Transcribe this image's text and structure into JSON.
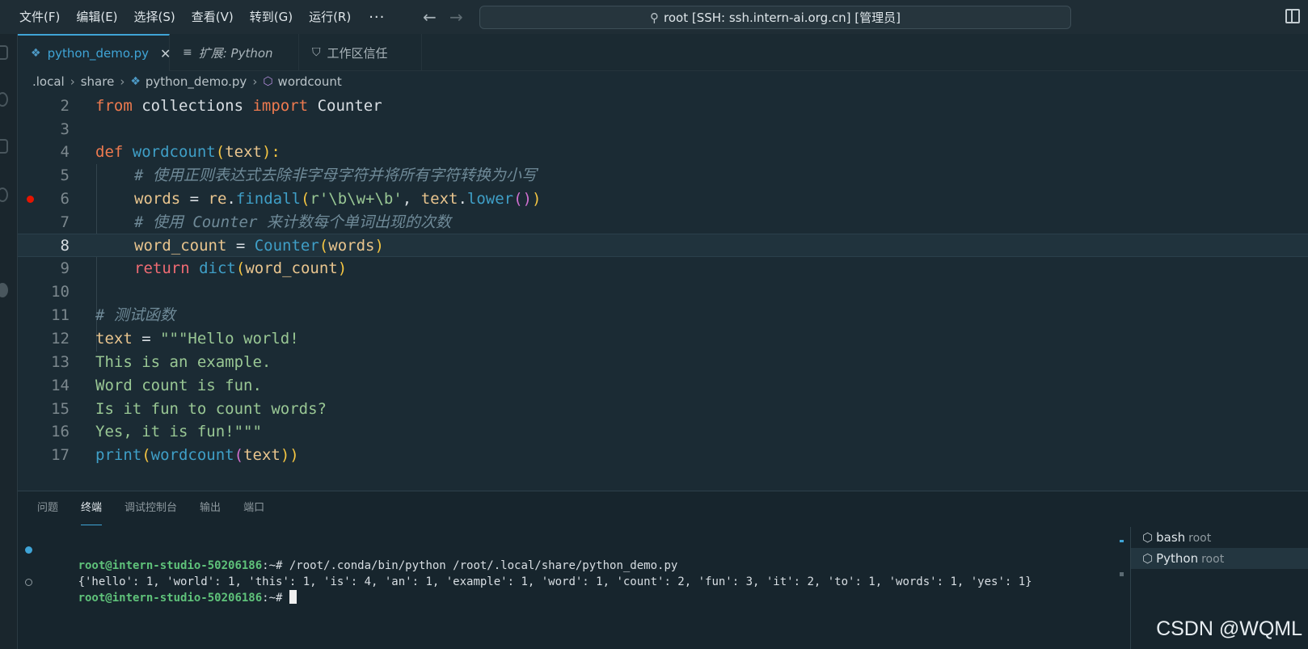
{
  "menu": [
    "文件(F)",
    "编辑(E)",
    "选择(S)",
    "查看(V)",
    "转到(G)",
    "运行(R)"
  ],
  "menu_more": "···",
  "command_center": "root [SSH: ssh.intern-ai.org.cn] [管理员]",
  "tabs": [
    {
      "label": "python_demo.py",
      "icon": "python-icon",
      "active": true
    },
    {
      "label": "扩展: Python",
      "icon": "preview-icon",
      "active": false
    },
    {
      "label": "工作区信任",
      "icon": "shield-icon",
      "active": false
    }
  ],
  "breadcrumb": [
    ".local",
    "share",
    "python_demo.py",
    "wordcount"
  ],
  "editor": {
    "current_line": "8",
    "breakpoint_line": "6",
    "lines": [
      {
        "n": "2"
      },
      {
        "n": "3"
      },
      {
        "n": "4"
      },
      {
        "n": "5"
      },
      {
        "n": "6"
      },
      {
        "n": "7"
      },
      {
        "n": "8"
      },
      {
        "n": "9"
      },
      {
        "n": "10"
      },
      {
        "n": "11"
      },
      {
        "n": "12"
      },
      {
        "n": "13"
      },
      {
        "n": "14"
      },
      {
        "n": "15"
      },
      {
        "n": "16"
      },
      {
        "n": "17"
      }
    ],
    "code": {
      "l2": [
        "from",
        " collections ",
        "import",
        " Counter"
      ],
      "l4": [
        "def",
        " ",
        "wordcount",
        "(",
        "text",
        "):"
      ],
      "l5": "# 使用正则表达式去除非字母字符并将所有字符转换为小写",
      "l6": [
        "words",
        " = ",
        "re",
        ".",
        "findall",
        "(",
        "r'\\b\\w+\\b'",
        ", ",
        "text",
        ".",
        "lower",
        "()",
        ")"
      ],
      "l7": "# 使用 Counter 来计数每个单词出现的次数",
      "l8": [
        "word_count",
        " = ",
        "Counter",
        "(",
        "words",
        ")"
      ],
      "l9": [
        "return",
        " ",
        "dict",
        "(",
        "word_count",
        ")"
      ],
      "l11": "# 测试函数",
      "l12": [
        "text",
        " = ",
        "\"\"\"Hello world!"
      ],
      "l13": "This is an example.",
      "l14": "Word count is fun.",
      "l15": "Is it fun to count words?",
      "l16": "Yes, it is fun!\"\"\"",
      "l17": [
        "print",
        "(",
        "wordcount",
        "(",
        "text",
        "))"
      ]
    }
  },
  "panel": {
    "tabs": [
      "问题",
      "终端",
      "调试控制台",
      "输出",
      "端口"
    ],
    "active_tab": "终端",
    "terminal": {
      "prompt": "root@intern-studio-50206186",
      "prompt_suffix": ":~# ",
      "command": "/root/.conda/bin/python /root/.local/share/python_demo.py",
      "output": "{'hello': 1, 'world': 1, 'this': 1, 'is': 4, 'an': 1, 'example': 1, 'word': 1, 'count': 2, 'fun': 3, 'it': 2, 'to': 1, 'words': 1, 'yes': 1}"
    },
    "terminals": [
      {
        "name": "bash",
        "user": "root"
      },
      {
        "name": "Python",
        "user": "root"
      }
    ]
  },
  "watermark": "CSDN @WQML",
  "colors": {
    "accent": "#3fa4d6",
    "breakpoint": "#e51400",
    "prompt": "#5fc27a"
  }
}
